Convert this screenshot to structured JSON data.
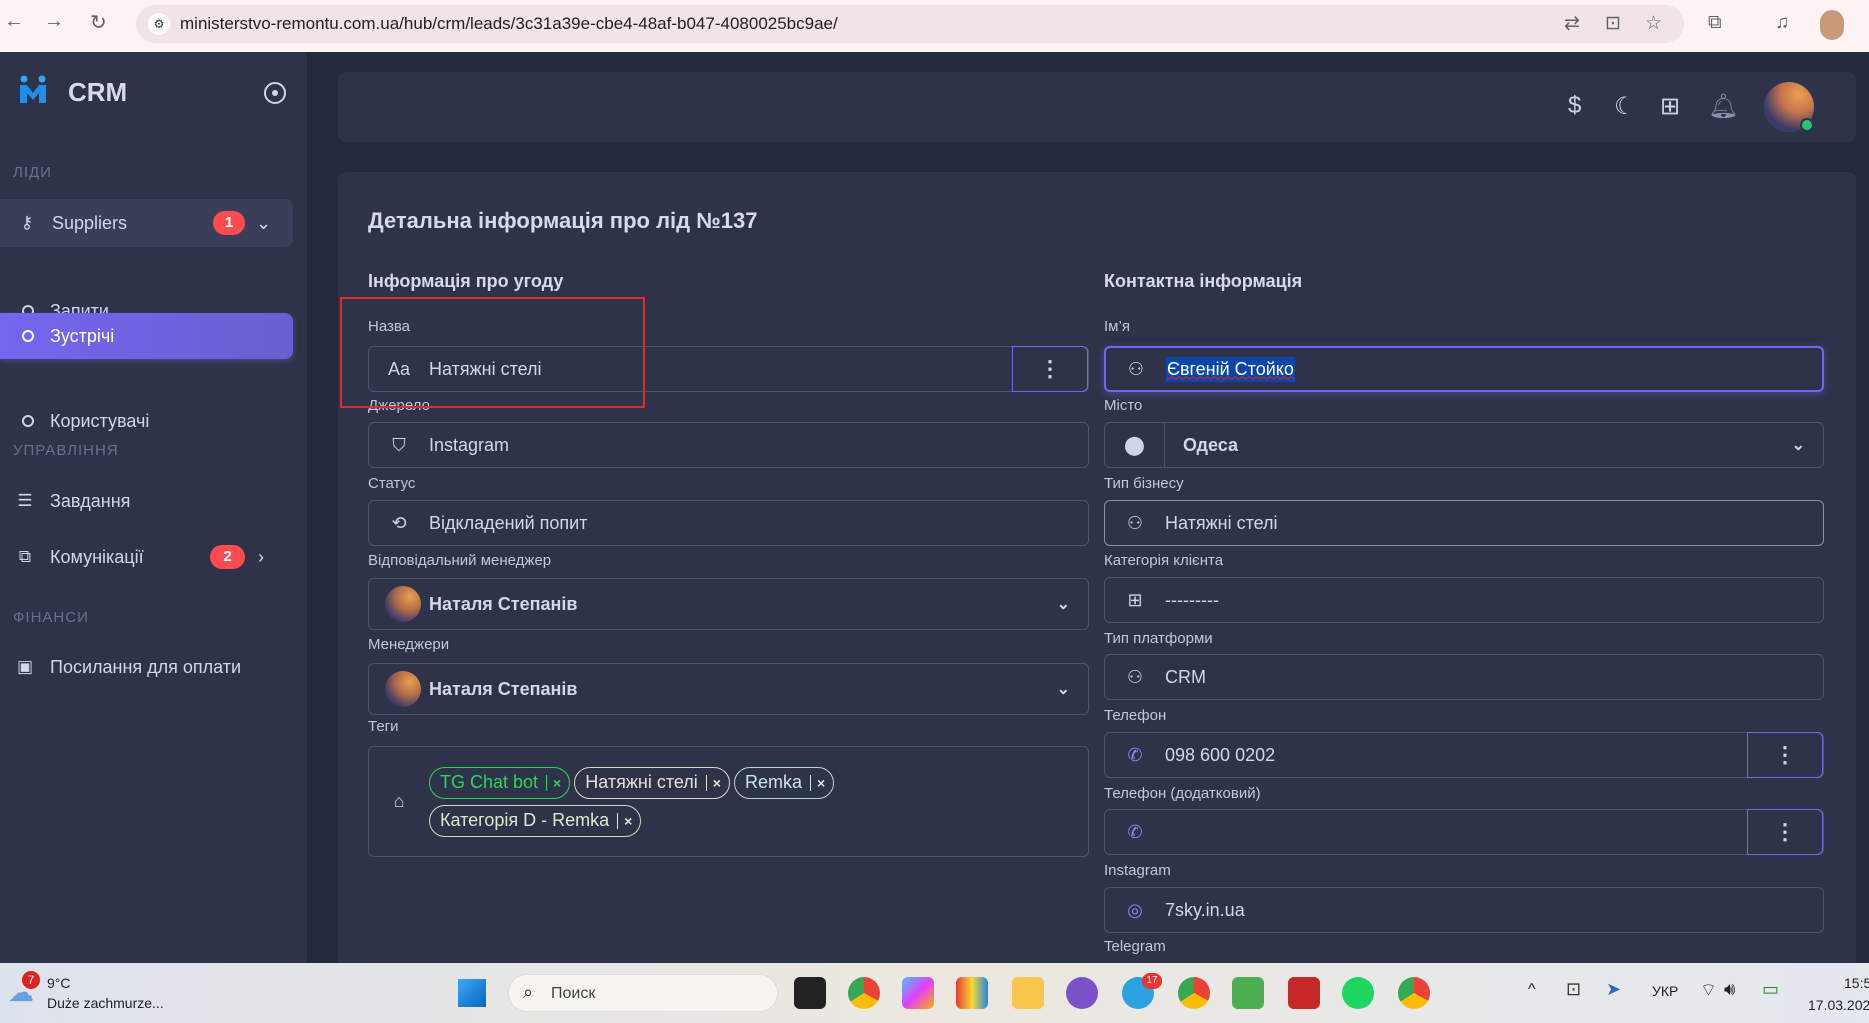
{
  "browser": {
    "url": "ministerstvo-remontu.com.ua/hub/crm/leads/3c31a39e-cbe4-48af-b047-4080025bc9ae/"
  },
  "sidebar": {
    "app_name": "CRM",
    "sections": [
      "ЛІДИ",
      "УПРАВЛІННЯ",
      "ФІНАНСИ"
    ],
    "suppliers": {
      "label": "Suppliers",
      "badge": "1"
    },
    "sub": [
      "Запити",
      "Зустрічі",
      "Користувачі"
    ],
    "tasks": "Завдання",
    "comms": {
      "label": "Комунікації",
      "badge": "2"
    },
    "payments": "Посилання для оплати"
  },
  "page": {
    "title": "Детальна інформація про лід №137",
    "deal": {
      "heading": "Інформація про угоду",
      "name": {
        "label": "Назва",
        "value": "Натяжні стелі"
      },
      "source": {
        "label": "Джерело",
        "value": "Instagram"
      },
      "status": {
        "label": "Статус",
        "value": "Відкладений попит"
      },
      "resp": {
        "label": "Відповідальний менеджер",
        "value": "Наталя Степанів"
      },
      "managers": {
        "label": "Менеджери",
        "value": "Наталя Степанів"
      },
      "tags": {
        "label": "Теги",
        "items": [
          "TG Chat bot",
          "Натяжні стелі",
          "Remka",
          "Категорія D - Remka"
        ],
        "x": "×"
      }
    },
    "contact": {
      "heading": "Контактна інформація",
      "name": {
        "label": "Ім’я",
        "value": "Євгеній Стойко"
      },
      "city": {
        "label": "Місто",
        "value": "Одеса"
      },
      "business": {
        "label": "Тип бізнесу",
        "value": "Натяжні стелі"
      },
      "category": {
        "label": "Категорія клієнта",
        "value": "---------"
      },
      "platform": {
        "label": "Тип платформи",
        "value": "CRM"
      },
      "phone": {
        "label": "Телефон",
        "value": "098 600 0202"
      },
      "phone2": {
        "label": "Телефон (додатковий)",
        "value": ""
      },
      "instagram": {
        "label": "Instagram",
        "value": "7sky.in.ua"
      },
      "telegram": {
        "label": "Telegram"
      }
    }
  },
  "taskbar": {
    "weather_temp": "9°C",
    "weather_desc": "Duże zachmurze...",
    "weather_badge": "7",
    "search": "Поиск",
    "lang": "УКР",
    "time": "15:5",
    "date": "17.03.202",
    "telegram_badge": "17"
  },
  "colors": {
    "accent": "#7367f0",
    "sidebar": "#2f3349",
    "bg": "#25293c",
    "danger": "#ff4c51",
    "tag_green": "#28d85a"
  }
}
